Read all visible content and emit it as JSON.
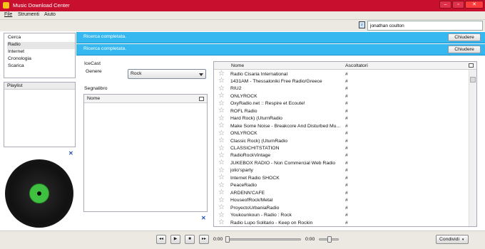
{
  "window": {
    "title": "Music Download Center"
  },
  "menu": [
    "File",
    "Strumenti",
    "Aiuto"
  ],
  "search": {
    "value": "jonathan coulton"
  },
  "nav": {
    "items": [
      "Cerca",
      "Radio",
      "Internet",
      "Cronologia",
      "Scarica"
    ],
    "selected": "Radio"
  },
  "playlist": {
    "title": "Playlist"
  },
  "notifications": [
    {
      "text": "Ricerca completata.",
      "button": "Chiudere"
    },
    {
      "text": "Ricerca completata.",
      "button": "Chiudere"
    }
  ],
  "icecast": {
    "title": "IceCast",
    "genre_label": "Genere",
    "genre_value": "Rock"
  },
  "bookmarks": {
    "title": "Segnalibro",
    "col_name": "Nome"
  },
  "table": {
    "col_name": "Nome",
    "col_listeners": "Ascoltatori",
    "rows": [
      {
        "name": "Radio Cisaria International",
        "listeners": "#"
      },
      {
        "name": "1431AM - Thessaloniki Free Radio/Greece",
        "listeners": "#"
      },
      {
        "name": "RIU2",
        "listeners": "#"
      },
      {
        "name": "ONLYROCK",
        "listeners": "#"
      },
      {
        "name": "OxyRadio.net :: Respire et Ecoute!",
        "listeners": "#"
      },
      {
        "name": "ROFL Radio",
        "listeners": "#"
      },
      {
        "name": "Hard Rock) (UturnRadio",
        "listeners": "#"
      },
      {
        "name": "Make Some Noise - Breakcore And Disturbed Mu...",
        "listeners": "#"
      },
      {
        "name": "ONLYROCK",
        "listeners": "#"
      },
      {
        "name": "Classic Rock) (UturnRadio",
        "listeners": "#"
      },
      {
        "name": "CLASSICHITSTATION",
        "listeners": "#"
      },
      {
        "name": "RadioRockVintage",
        "listeners": "#"
      },
      {
        "name": "JUKEBOX RADIO - Non Commercial Web Radio",
        "listeners": "#"
      },
      {
        "name": "jolio'sparty",
        "listeners": "#"
      },
      {
        "name": "Internet Radio SHOCK",
        "listeners": "#"
      },
      {
        "name": "PeaceRadio",
        "listeners": "#"
      },
      {
        "name": "ARDENN'CAFE",
        "listeners": "#"
      },
      {
        "name": "HouseofRock/Metal",
        "listeners": "#"
      },
      {
        "name": "ProyectoUrbaniaRadio",
        "listeners": "#"
      },
      {
        "name": "Youkounkoun - Radio : Rock",
        "listeners": "#"
      },
      {
        "name": "Radio Lupo Solitario - Keep on Rockin",
        "listeners": "#"
      }
    ]
  },
  "player": {
    "time_start": "0:00",
    "time_end": "0:00",
    "share": "Condividi"
  },
  "icons": [
    "app-icon",
    "search-icon",
    "star-icon",
    "column-picker-icon",
    "close-icon",
    "vinyl-record-icon",
    "prev-icon",
    "play-icon",
    "stop-icon",
    "next-icon"
  ],
  "colors": {
    "titlebar": "#c8102e",
    "notification": "#35b7f0",
    "vinyl_label": "#3fc040",
    "link_x": "#1f4fb5"
  }
}
